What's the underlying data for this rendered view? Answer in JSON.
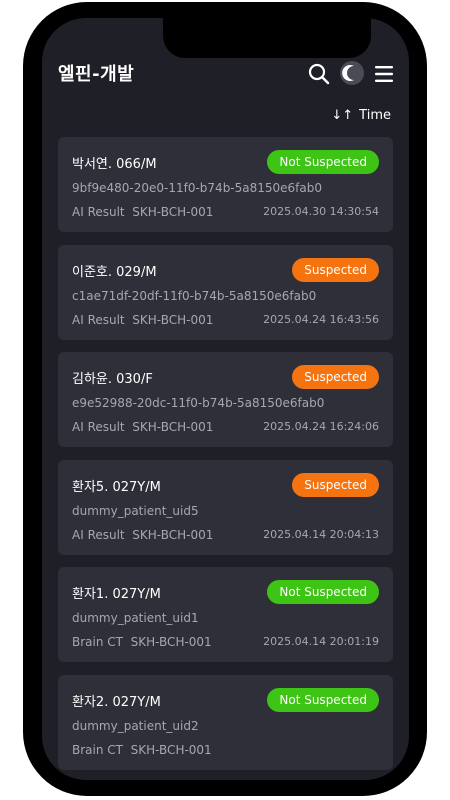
{
  "app": {
    "title": "엘핀-개발"
  },
  "toolbar": {
    "sort_label": "Time",
    "sort_icon": "↓↑"
  },
  "colors": {
    "not_suspected": "#3ec414",
    "suspected": "#f57410",
    "card_bg": "#2e2f38",
    "screen_bg": "#1f2027"
  },
  "cards": [
    {
      "name": "박서연. 066/M",
      "status": "Not Suspected",
      "uid": "9bf9e480-20e0-11f0-b74b-5a8150e6fab0",
      "type": "AI Result",
      "device": "SKH-BCH-001",
      "date": "2025.04.30 14:30:54"
    },
    {
      "name": "이준호. 029/M",
      "status": "Suspected",
      "uid": "c1ae71df-20df-11f0-b74b-5a8150e6fab0",
      "type": "AI Result",
      "device": "SKH-BCH-001",
      "date": "2025.04.24 16:43:56"
    },
    {
      "name": "김하윤. 030/F",
      "status": "Suspected",
      "uid": "e9e52988-20dc-11f0-b74b-5a8150e6fab0",
      "type": "AI Result",
      "device": "SKH-BCH-001",
      "date": "2025.04.24 16:24:06"
    },
    {
      "name": "환자5. 027Y/M",
      "status": "Suspected",
      "uid": "dummy_patient_uid5",
      "type": "AI Result",
      "device": "SKH-BCH-001",
      "date": "2025.04.14 20:04:13"
    },
    {
      "name": "환자1. 027Y/M",
      "status": "Not Suspected",
      "uid": "dummy_patient_uid1",
      "type": "Brain CT",
      "device": "SKH-BCH-001",
      "date": "2025.04.14 20:01:19"
    },
    {
      "name": "환자2. 027Y/M",
      "status": "Not Suspected",
      "uid": "dummy_patient_uid2",
      "type": "Brain CT",
      "device": "SKH-BCH-001",
      "date": ""
    }
  ]
}
